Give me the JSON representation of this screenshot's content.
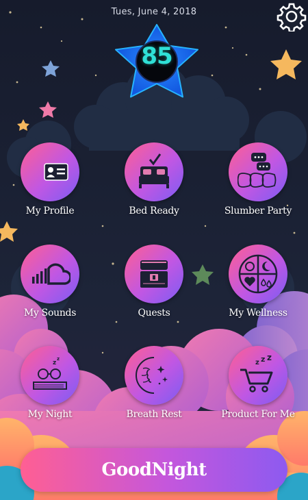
{
  "header": {
    "date": "Tues, June 4, 2018",
    "score": "85"
  },
  "settings": {
    "icon": "gear-icon"
  },
  "tiles": [
    {
      "label": "My Profile",
      "icon": "id-card-icon"
    },
    {
      "label": "Bed Ready",
      "icon": "bed-checkmark-icon"
    },
    {
      "label": "Slumber Party",
      "icon": "pillows-chat-icon"
    },
    {
      "label": "My Sounds",
      "icon": "sound-cloud-icon"
    },
    {
      "label": "Quests",
      "icon": "treasure-chest-icon"
    },
    {
      "label": "My Wellness",
      "icon": "wellness-quadrants-icon"
    },
    {
      "label": "My Night",
      "icon": "sleeping-book-icon"
    },
    {
      "label": "Breath Rest",
      "icon": "moon-face-icon"
    },
    {
      "label": "Product  For Me",
      "icon": "shopping-cart-icon"
    }
  ],
  "footer": {
    "button_label": "GoodNight"
  },
  "colors": {
    "accent_pink": "#ff5f93",
    "accent_purple": "#8d5af0",
    "score_teal": "#2fe0d6",
    "background": "#1c2235"
  }
}
